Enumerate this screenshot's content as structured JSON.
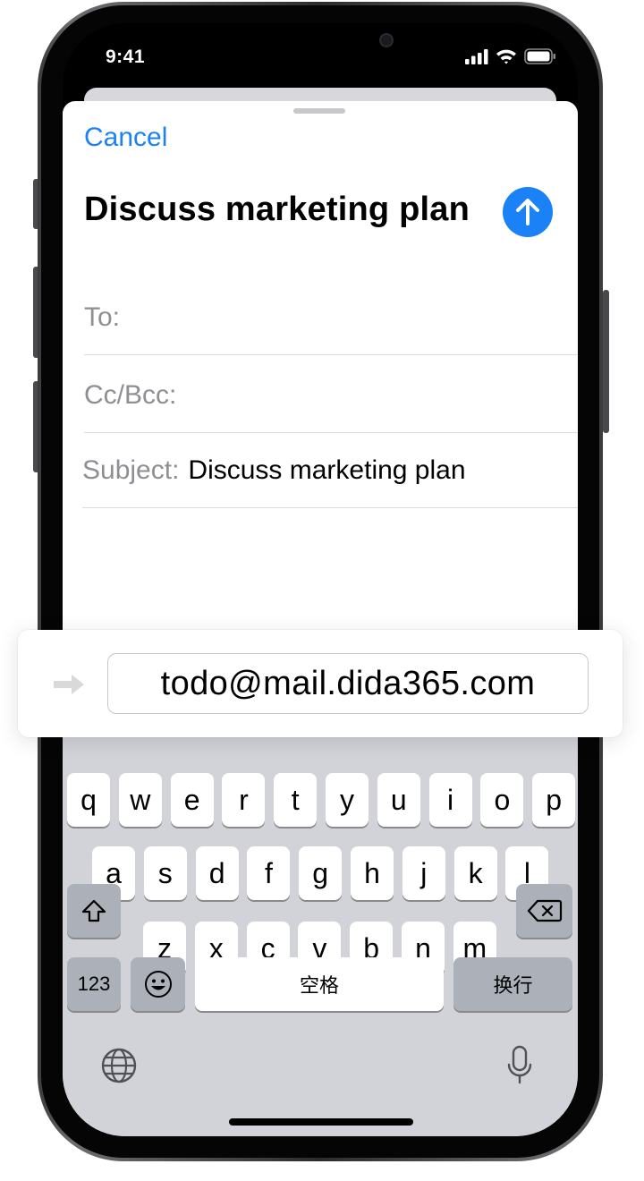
{
  "status_bar": {
    "time": "9:41"
  },
  "compose": {
    "cancel_label": "Cancel",
    "title": "Discuss marketing plan",
    "to_label": "To:",
    "cc_label": "Cc/Bcc:",
    "subject_label": "Subject:",
    "subject_value": "Discuss marketing plan"
  },
  "address_bar": {
    "email": "todo@mail.dida365.com"
  },
  "keyboard": {
    "row1": [
      "q",
      "w",
      "e",
      "r",
      "t",
      "y",
      "u",
      "i",
      "o",
      "p"
    ],
    "row2": [
      "a",
      "s",
      "d",
      "f",
      "g",
      "h",
      "j",
      "k",
      "l"
    ],
    "row3": [
      "z",
      "x",
      "c",
      "v",
      "b",
      "n",
      "m"
    ],
    "numbers_label": "123",
    "space_label": "空格",
    "return_label": "换行"
  },
  "icons": {
    "send": "arrow-up-icon",
    "shift": "shift-icon",
    "delete": "delete-backspace-icon",
    "emoji": "emoji-icon",
    "globe": "globe-icon",
    "mic": "microphone-icon",
    "arrow": "arrow-right-icon"
  },
  "colors": {
    "accent": "#1a82f6",
    "keyboard_bg": "#d1d3d9"
  }
}
